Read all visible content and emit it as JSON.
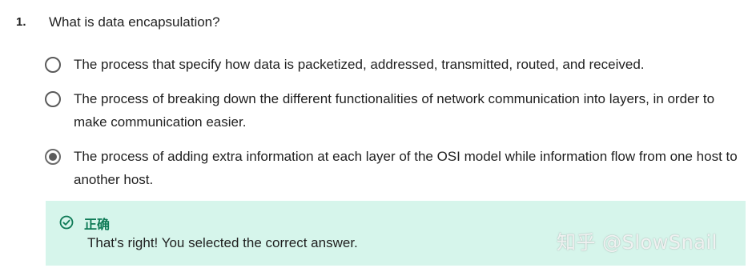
{
  "question": {
    "number": "1.",
    "text": "What is data encapsulation?"
  },
  "options": [
    {
      "text": "The process that specify how data is packetized, addressed, transmitted, routed, and received.",
      "selected": false
    },
    {
      "text": "The process of breaking down the different functionalities of network communication into layers, in order to make communication easier.",
      "selected": false
    },
    {
      "text": "The process of adding extra information at each layer of the OSI model while information flow from one host to another host.",
      "selected": true
    }
  ],
  "feedback": {
    "status": "正确",
    "message": "That's right! You selected the correct answer.",
    "icon": "check-circle-icon",
    "accent_color": "#0e7a56",
    "background_color": "#d6f5eb"
  },
  "watermark": {
    "text": "知乎 @SlowSnail"
  }
}
